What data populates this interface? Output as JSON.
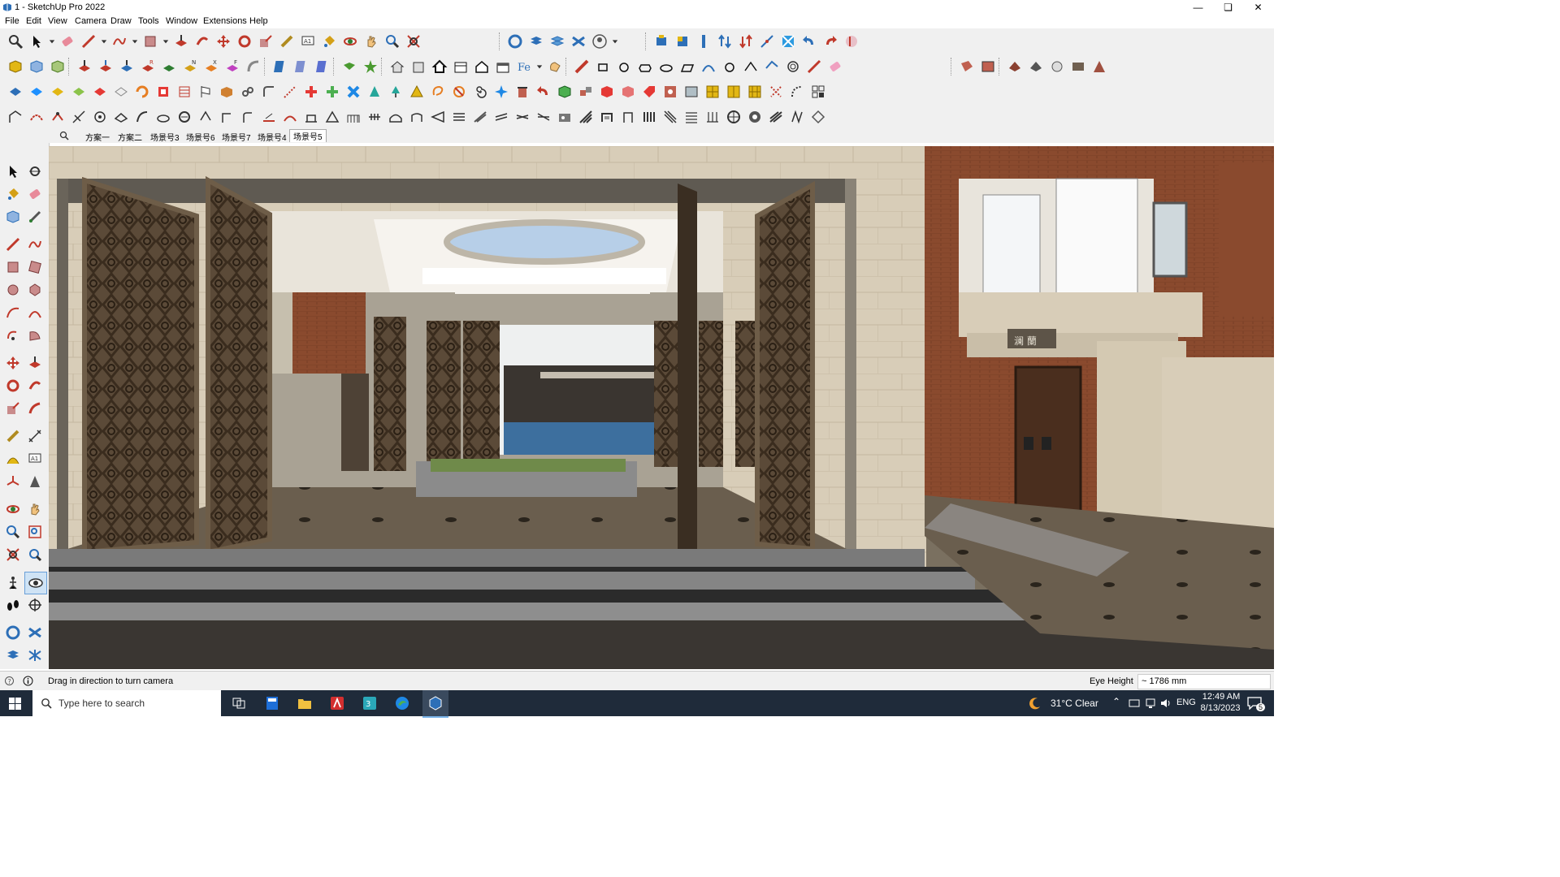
{
  "window": {
    "title": "1 - SketchUp Pro 2022"
  },
  "menu": [
    "File",
    "Edit",
    "View",
    "Camera",
    "Draw",
    "Tools",
    "Window",
    "Extensions",
    "Help"
  ],
  "scenes": {
    "tabs": [
      "方案一",
      "方案二",
      "场景号3",
      "场景号6",
      "场景号7",
      "场景号4",
      "场景号5"
    ],
    "active": "场景号5"
  },
  "viewport": {
    "signage_text": "澜 蘭"
  },
  "status": {
    "hint": "Drag in direction to turn camera",
    "measure_label": "Eye Height",
    "measure_value": "~ 1786 mm"
  },
  "taskbar": {
    "search_placeholder": "Type here to search",
    "weather": "31°C  Clear",
    "language": "ENG",
    "time": "12:49 AM",
    "date": "8/13/2023",
    "notification_count": "5"
  }
}
